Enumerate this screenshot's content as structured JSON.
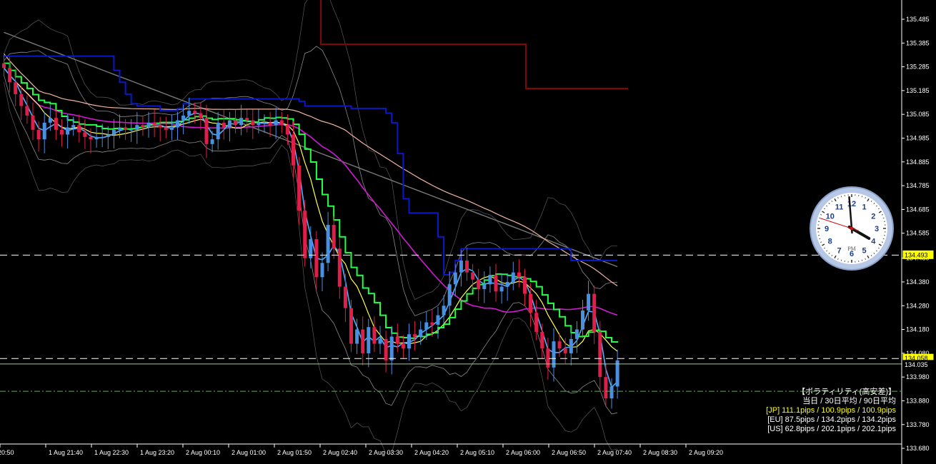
{
  "chart_data": {
    "type": "candlestick",
    "y_ticks": [
      "135.485",
      "135.385",
      "135.285",
      "135.185",
      "135.085",
      "134.985",
      "134.885",
      "134.785",
      "134.685",
      "134.585",
      "134.480",
      "134.380",
      "134.280",
      "134.180",
      "134.080",
      "133.980",
      "133.880",
      "133.780",
      "133.680"
    ],
    "x_ticks": [
      "20:50",
      "1 Aug 21:40",
      "1 Aug 22:30",
      "1 Aug 23:20",
      "2 Aug 00:10",
      "2 Aug 01:00",
      "2 Aug 01:50",
      "2 Aug 02:40",
      "2 Aug 03:30",
      "2 Aug 04:20",
      "2 Aug 05:10",
      "2 Aug 06:00",
      "2 Aug 06:50",
      "2 Aug 07:40",
      "2 Aug 08:30",
      "2 Aug 09:20"
    ],
    "ylim": [
      133.652,
      135.52
    ],
    "price_tags": [
      {
        "label": "134.493",
        "value": 134.493,
        "color": "#ffff00"
      },
      {
        "label": "134.058",
        "value": 134.058,
        "color": "#ffff00"
      },
      {
        "label": "134.035",
        "value": 134.035,
        "color": "#ffffff"
      }
    ],
    "horizontal_lines": [
      134.493,
      134.058,
      134.035,
      133.92
    ],
    "candles_close": [
      135.28,
      135.22,
      135.17,
      135.12,
      135.08,
      135.02,
      134.98,
      135.05,
      135.07,
      135.02,
      135.0,
      135.03,
      135.04,
      135.01,
      134.99,
      134.98,
      134.99,
      134.99,
      135.0,
      135.02,
      135.03,
      135.02,
      135.02,
      135.04,
      135.03,
      135.05,
      135.04,
      135.03,
      135.02,
      135.03,
      135.06,
      135.08,
      135.1,
      135.09,
      135.07,
      134.96,
      134.98,
      135.05,
      135.03,
      135.06,
      135.04,
      135.07,
      135.06,
      135.04,
      135.05,
      135.05,
      135.04,
      135.06,
      135.04,
      135.0,
      134.87,
      134.68,
      134.48,
      134.56,
      134.4,
      134.46,
      134.62,
      134.52,
      134.36,
      134.27,
      134.12,
      134.18,
      134.08,
      134.19,
      134.12,
      134.14,
      134.05,
      134.15,
      134.12,
      134.1,
      134.16,
      134.15,
      134.18,
      134.21,
      134.2,
      134.24,
      134.28,
      134.37,
      134.42,
      134.47,
      134.42,
      134.39,
      134.35,
      134.37,
      134.41,
      134.34,
      134.36,
      134.38,
      134.42,
      134.4,
      134.33,
      134.25,
      134.17,
      134.1,
      134.02,
      134.13,
      134.1,
      134.08,
      134.14,
      134.18,
      134.26,
      134.33,
      134.17,
      133.98,
      133.89,
      133.94,
      134.05
    ],
    "volatility_panel": {
      "title": "【ボラティリティ(高安差)】",
      "header": "当日 / 30日平均 / 90日平均",
      "rows": [
        {
          "label": "[JP] 111.1pips / 100.9pips / 100.9pips",
          "color": "#ffff00"
        },
        {
          "label": "[EU] 87.5pips / 134.2pips / 134.2pips",
          "color": "#ffffff"
        },
        {
          "label": "[US] 62.8pips / 202.1pips / 202.1pips",
          "color": "#ffffff"
        }
      ]
    },
    "clock": {
      "numerals": [
        "12",
        "1",
        "2",
        "3",
        "4",
        "5",
        "6",
        "7",
        "8",
        "9",
        "10",
        "11"
      ],
      "period": "PM",
      "hour": 4,
      "minute": 0,
      "second": 48
    }
  }
}
